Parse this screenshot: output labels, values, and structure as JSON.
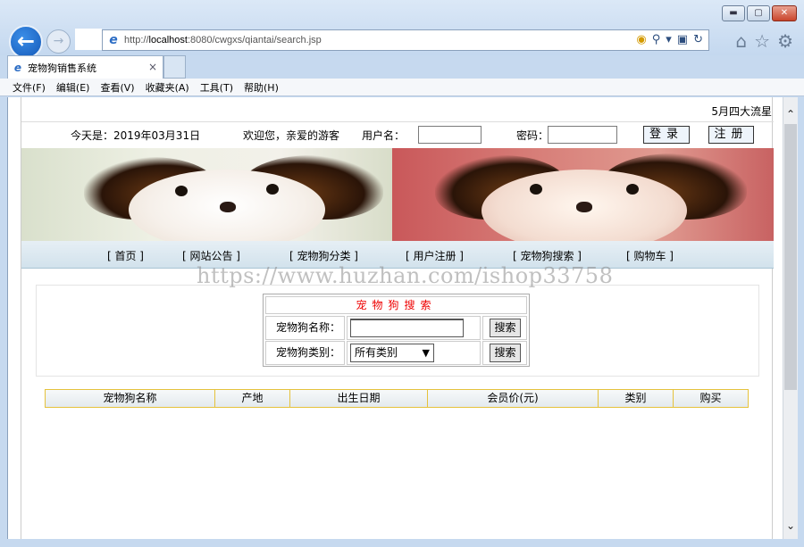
{
  "browser": {
    "url_prefix": "http://",
    "url_host": "localhost",
    "url_rest": ":8080/cwgxs/qiantai/search.jsp",
    "tab_title": "宠物狗销售系统",
    "tab_close": "×",
    "menu": [
      "文件(F)",
      "编辑(E)",
      "查看(V)",
      "收藏夹(A)",
      "工具(T)",
      "帮助(H)"
    ]
  },
  "page": {
    "marquee": "5月四大流星",
    "date_text": "今天是：2019年03月31日",
    "welcome": "欢迎您，亲爱的游客",
    "username_label": "用户名：",
    "password_label": "密码：",
    "login_button": "登录",
    "register_button": "注册",
    "nav": [
      "[ 首页 ]",
      "[ 网站公告 ]",
      "[ 宠物狗分类 ]",
      "[ 用户注册 ]",
      "[ 宠物狗搜索 ]",
      "[ 购物车 ]"
    ],
    "watermark": "https://www.huzhan.com/ishop33758"
  },
  "search": {
    "title": "宠物狗搜索",
    "name_label": "宠物狗名称：",
    "name_value": "",
    "category_label": "宠物狗类别：",
    "category_value": "所有类别",
    "search_button": "搜索"
  },
  "results": {
    "headers": [
      "宠物狗名称",
      "产地",
      "出生日期",
      "会员价(元)",
      "类别",
      "购买"
    ]
  }
}
